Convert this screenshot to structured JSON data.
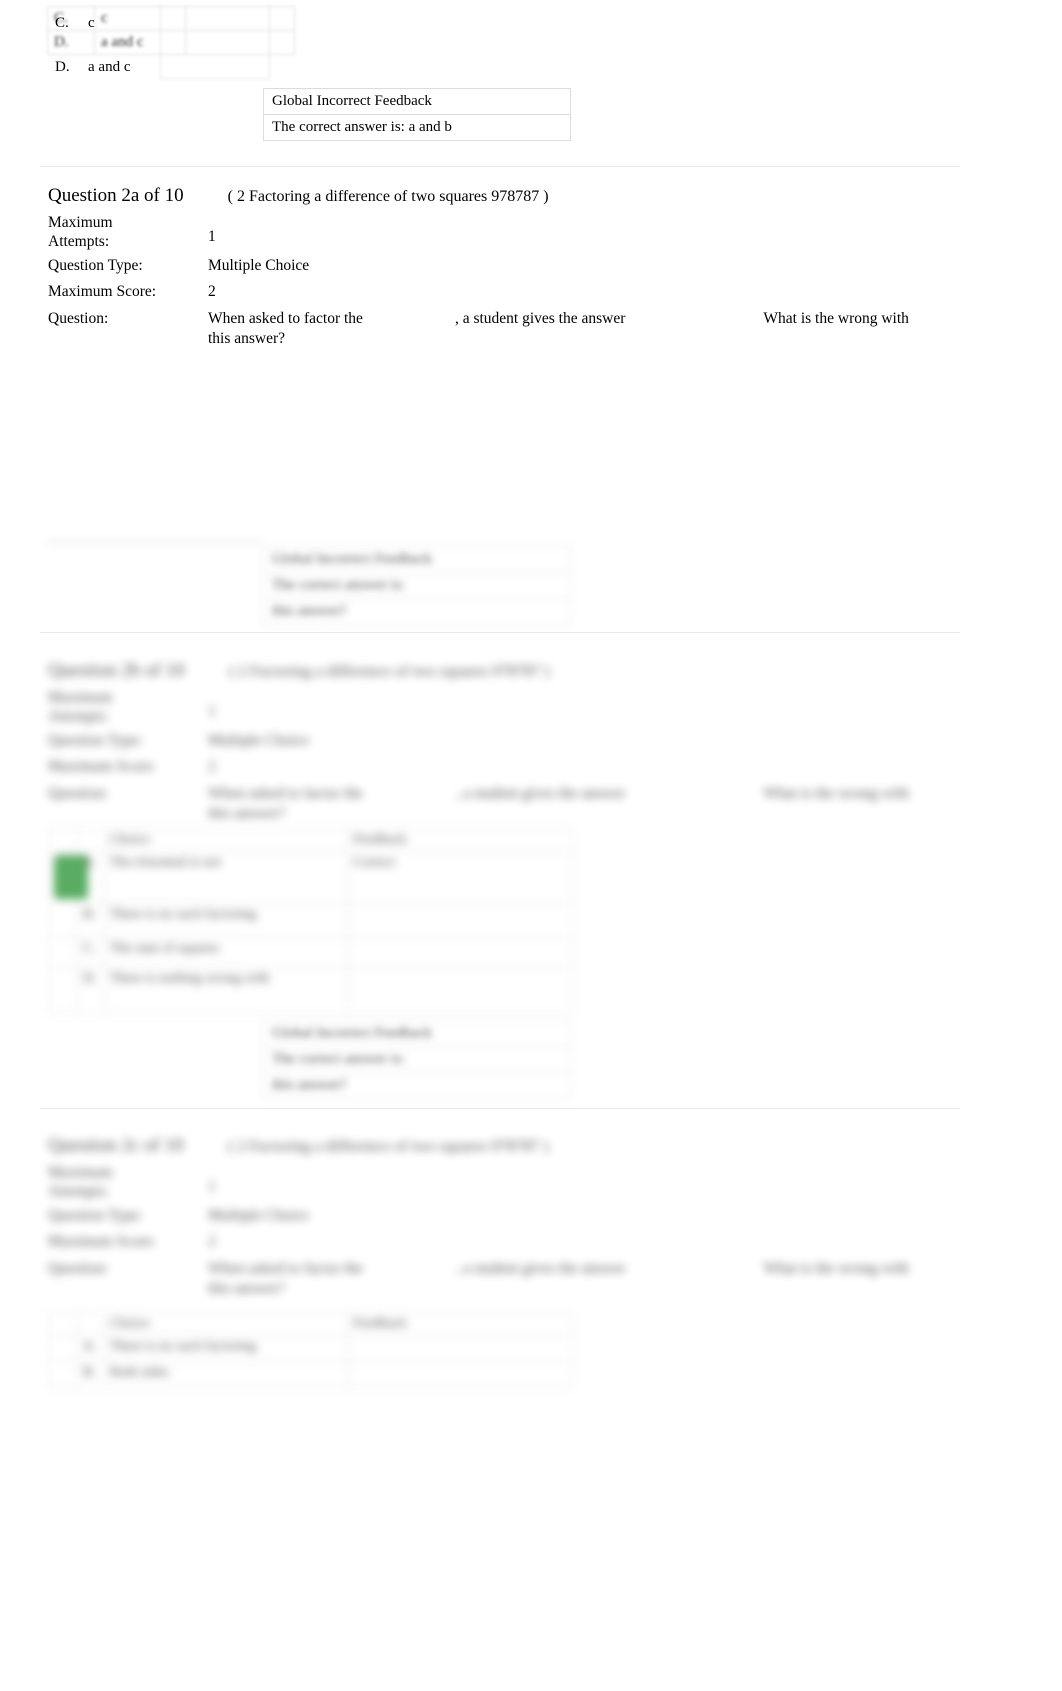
{
  "document": {
    "type": "quiz-review-printout"
  },
  "top_fragment": {
    "options": [
      {
        "letter": "C.",
        "text": "c",
        "mid": "",
        "right": ""
      },
      {
        "letter": "D.",
        "text": "a and c",
        "mid": "",
        "right": ""
      }
    ],
    "feedback": {
      "heading": "Global Incorrect Feedback",
      "body": "The correct answer is: a and b"
    }
  },
  "question_2a": {
    "title": "Question 2a of 10",
    "source": "( 2 Factoring a difference of two squares 978787 )",
    "meta": [
      {
        "label": "Maximum Attempts:",
        "value": "1"
      },
      {
        "label": "Question Type:",
        "value": "Multiple Choice"
      },
      {
        "label": "Maximum Score:",
        "value": "2"
      }
    ],
    "question_label": "Question:",
    "question_parts": {
      "part1": "When asked to factor the",
      "part2": ", a student gives the answer",
      "part3": "What is the wrong with",
      "part4": "this answer?"
    },
    "feedback": {
      "heading": "Global Incorrect Feedback",
      "line2": "The correct answer is:",
      "line3": "this answer?"
    }
  },
  "question_2b": {
    "title": "Question 2b of 10",
    "source": "( 2 Factoring a difference of two squares 978787 )",
    "meta": [
      {
        "label": "Maximum Attempts:",
        "value": "1"
      },
      {
        "label": "Question Type:",
        "value": "Multiple Choice"
      },
      {
        "label": "Maximum Score:",
        "value": "2"
      }
    ],
    "question_label": "Question:",
    "question_parts": {
      "part1": "When asked to factor the",
      "part2": ", a student gives the answer",
      "part3": "What is the wrong with",
      "part4": "this answer?"
    },
    "answer_table": {
      "headers": [
        "",
        "",
        "Choice",
        "Feedback"
      ],
      "rows": [
        {
          "mark": "selected",
          "letter": "A.",
          "choice": "The trinomial is not",
          "feedback": "Correct"
        },
        {
          "mark": "",
          "letter": "B.",
          "choice": "There is no such factoring",
          "feedback": ""
        },
        {
          "mark": "",
          "letter": "C.",
          "choice": "The sum of squares",
          "feedback": ""
        },
        {
          "mark": "",
          "letter": "D.",
          "choice": "There is nothing wrong with",
          "feedback": ""
        }
      ]
    },
    "feedback": {
      "heading": "Global Incorrect Feedback",
      "line2": "The correct answer is:",
      "line3": "this answer?"
    }
  },
  "question_2c": {
    "title": "Question 2c of 10",
    "source": "( 2 Factoring a difference of two squares 978787 )",
    "meta": [
      {
        "label": "Maximum Attempts:",
        "value": "1"
      },
      {
        "label": "Question Type:",
        "value": "Multiple Choice"
      },
      {
        "label": "Maximum Score:",
        "value": "2"
      }
    ],
    "question_label": "Question:",
    "question_parts": {
      "part1": "When asked to factor the",
      "part2": ", a student gives the answer",
      "part3": "What is the wrong with",
      "part4": "this answer?"
    },
    "answer_table": {
      "headers": [
        "",
        "",
        "Choice",
        "Feedback"
      ],
      "rows": [
        {
          "mark": "",
          "letter": "A.",
          "choice": "There is no such factoring",
          "feedback": ""
        },
        {
          "mark": "",
          "letter": "B.",
          "choice": "Both sides",
          "feedback": ""
        }
      ]
    }
  },
  "colors": {
    "selected_marker": "#138a1f",
    "rule": "#e8e8e8",
    "table_border": "#dcdcdc"
  }
}
